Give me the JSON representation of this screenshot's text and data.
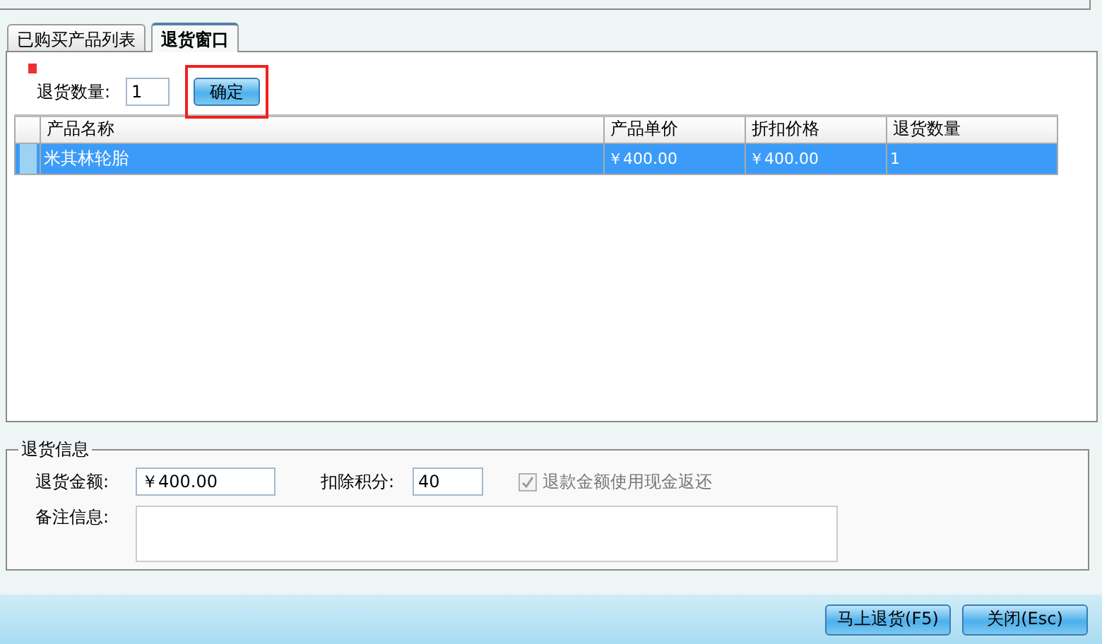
{
  "tabs": [
    {
      "label": "已购买产品列表",
      "selected": false
    },
    {
      "label": "退货窗口",
      "selected": true
    }
  ],
  "return_quantity": {
    "flagged": true,
    "label": "退货数量:",
    "value": "1",
    "confirm_button": {
      "label": "确定",
      "highlighted": true
    }
  },
  "table": {
    "columns": [
      "产品名称",
      "产品单价",
      "折扣价格",
      "退货数量"
    ],
    "rows": [
      {
        "selected": true,
        "cells": [
          "米其林轮胎",
          "￥400.00",
          "￥400.00",
          "1"
        ]
      }
    ]
  },
  "return_info": {
    "title": "退货信息",
    "amount_label": "退货金额:",
    "amount_value": "￥400.00",
    "points_label": "扣除积分:",
    "points_value": "40",
    "cash_refund": {
      "label": "退款金额使用现金返还",
      "checked": true,
      "disabled": true
    },
    "note_label": "备注信息:"
  },
  "buttons": [
    "马上退货(F5)",
    "关闭(Esc)"
  ]
}
